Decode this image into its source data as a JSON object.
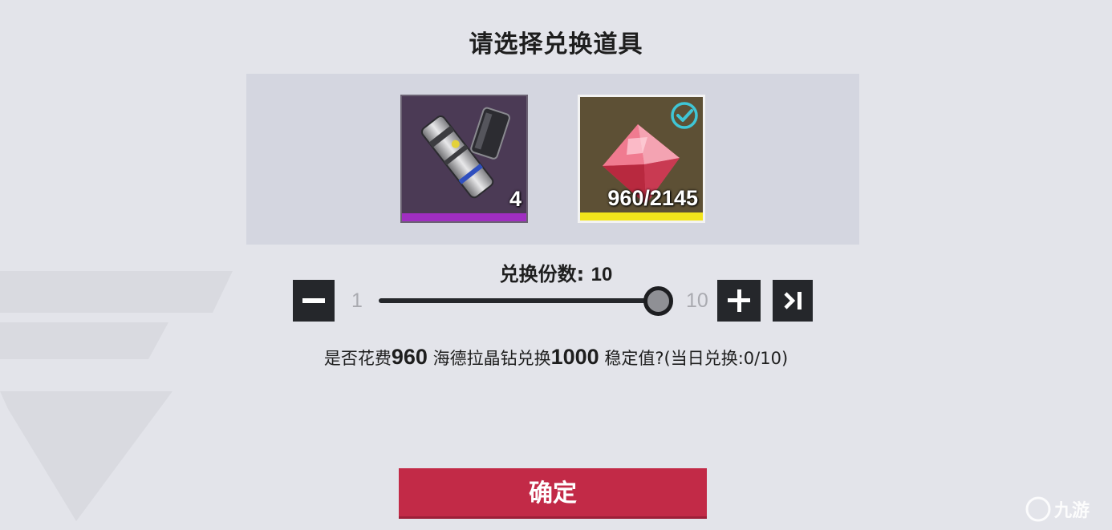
{
  "dialog": {
    "title": "请选择兑换道具",
    "items": [
      {
        "icon": "cartridge-item-icon",
        "count": "4",
        "rarity_color": "#a02ec2",
        "selected": false
      },
      {
        "icon": "red-crystal-diamond-icon",
        "count": "960/2145",
        "rarity_color": "#f2e41c",
        "selected": true
      }
    ],
    "quantity": {
      "label": "兑换份数:",
      "value": "10",
      "min": "1",
      "max": "10",
      "fraction_of_range": 1.0
    },
    "confirm_message": {
      "prefix": "是否花费",
      "cost": "960",
      "currency": "海德拉晶钻兑换",
      "amount": "1000",
      "suffix": "稳定值?(当日兑换:0/10)"
    },
    "confirm_button": "确定"
  },
  "colors": {
    "accent": "#c22a47",
    "selected_check": "#3fc6d6"
  },
  "watermark": "九游"
}
